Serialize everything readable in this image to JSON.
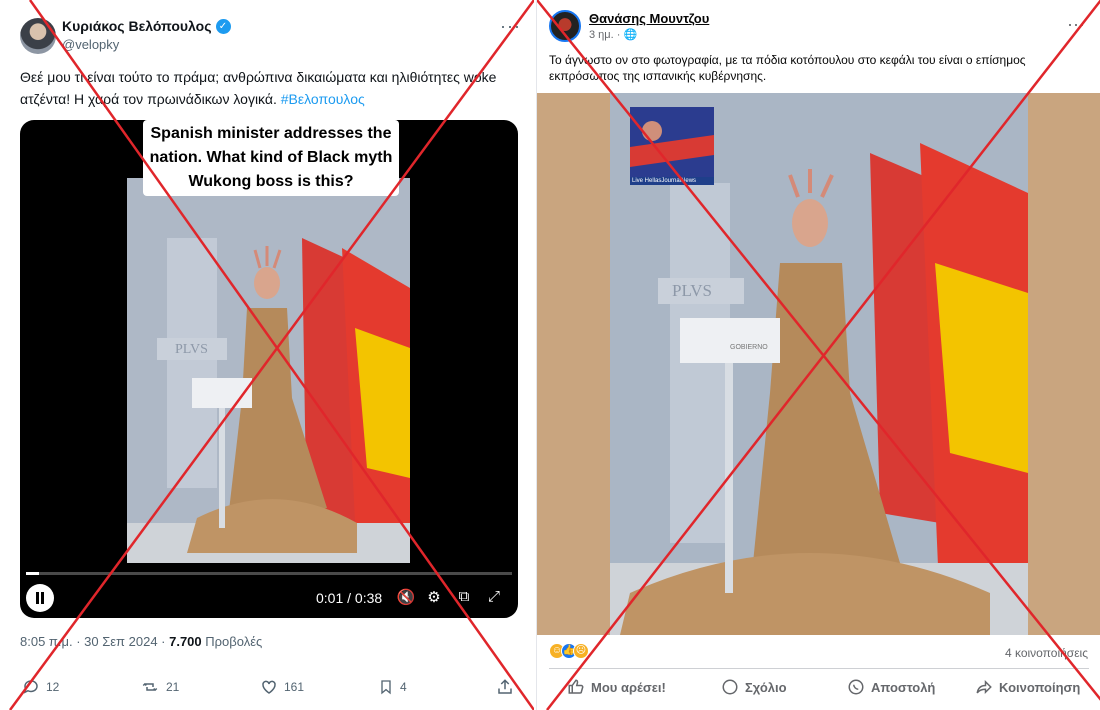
{
  "twitter": {
    "author_name": "Κυριάκος Βελόπουλος",
    "handle": "@velopky",
    "more": "···",
    "text_main": "Θεέ μου τι είναι τούτο το πράμα; ανθρώπινα δικαιώματα και ηλιθιότητες woke  ατζέντα! Η χαρά τον πρωινάδικων λογικά. ",
    "hashtag": "#Βελοπουλος",
    "video": {
      "caption": "Spanish minister addresses the nation. What kind of Black myth Wukong boss is this?",
      "time": "0:01 / 0:38",
      "progress": 0.026
    },
    "meta_time": "8:05 π.μ. · 30 Σεπ 2024 · ",
    "views_count": "7.700",
    "views_label": " Προβολές",
    "actions": {
      "replies": "12",
      "reposts": "21",
      "likes": "161",
      "bookmarks": "4"
    }
  },
  "facebook": {
    "author_name": "Θανάσης Μουντζου",
    "time": "3 ημ. · ",
    "more": "···",
    "text": "Το άγνωστο ον στο φωτογραφία, με τα πόδια κοτόπουλου στο κεφάλι του είναι ο επίσημος εκπρόσωπος της ισπανικής κυβέρνησης.",
    "thumb_label": "Live HellasJournalNews",
    "shares": "4 κοινοποιήσεις",
    "actions": {
      "like": "Μου αρέσει!",
      "comment": "Σχόλιο",
      "send": "Αποστολή",
      "share": "Κοινοποίηση"
    }
  },
  "colors": {
    "x_accent": "#1d9bf0",
    "fb_accent": "#1877f2",
    "cross_red": "#e0262b"
  }
}
